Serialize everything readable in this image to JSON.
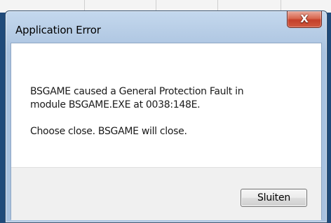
{
  "window": {
    "title": "Application Error",
    "close_glyph": "X"
  },
  "message": {
    "line1": "BSGAME caused a General Protection Fault in",
    "line2": "module BSGAME.EXE at 0038:148E.",
    "line3": "Choose close. BSGAME will close."
  },
  "buttons": {
    "close_label": "Sluiten"
  },
  "colors": {
    "frame_blue": "#a9c2e0",
    "close_button_red": "#c4402a",
    "desktop_dark_blue": "#1f4a7a"
  }
}
